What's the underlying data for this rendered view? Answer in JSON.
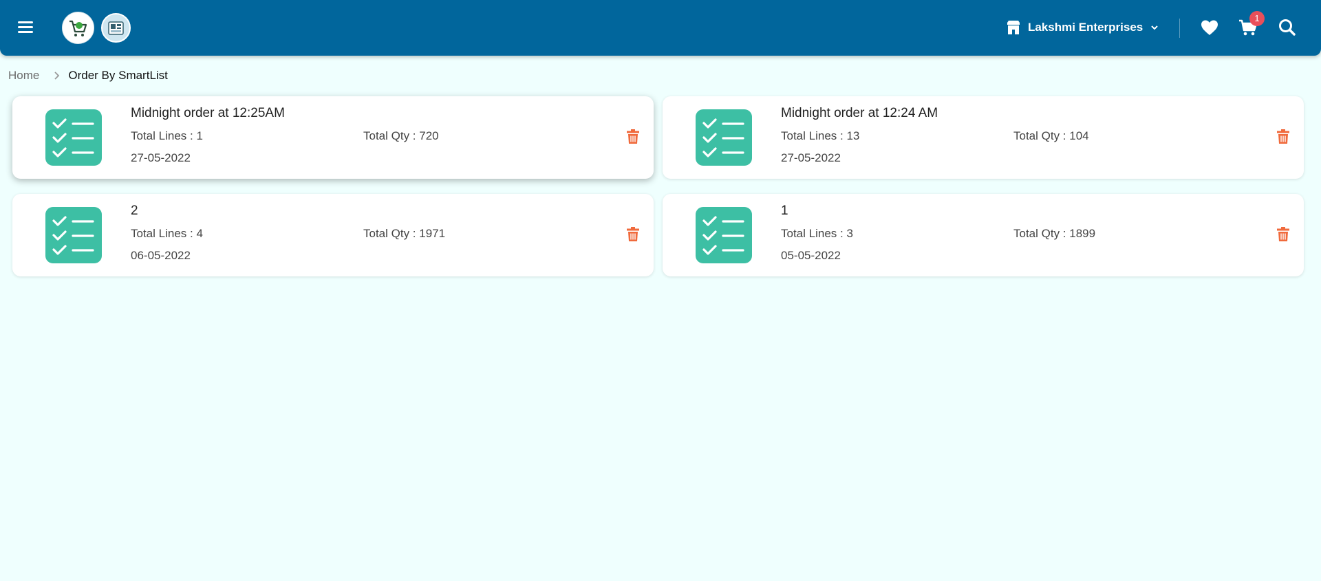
{
  "header": {
    "store_name": "Lakshmi Enterprises",
    "cart_count": "1"
  },
  "breadcrumb": {
    "home": "Home",
    "current": "Order By SmartList"
  },
  "orders": [
    {
      "title": "Midnight order at 12:25AM",
      "lines": "Total Lines : 1",
      "qty": "Total Qty : 720",
      "date": "27-05-2022"
    },
    {
      "title": "Midnight order at 12:24 AM",
      "lines": "Total Lines : 13",
      "qty": "Total Qty : 104",
      "date": "27-05-2022"
    },
    {
      "title": "2",
      "lines": "Total Lines : 4",
      "qty": "Total Qty : 1971",
      "date": "06-05-2022"
    },
    {
      "title": "1",
      "lines": "Total Lines : 3",
      "qty": "Total Qty : 1899",
      "date": "05-05-2022"
    }
  ],
  "colors": {
    "header_bg": "#01669c",
    "page_bg": "#effffe",
    "list_icon": "#3dbfa4",
    "delete": "#f06a3c",
    "badge": "#e94f5a"
  }
}
